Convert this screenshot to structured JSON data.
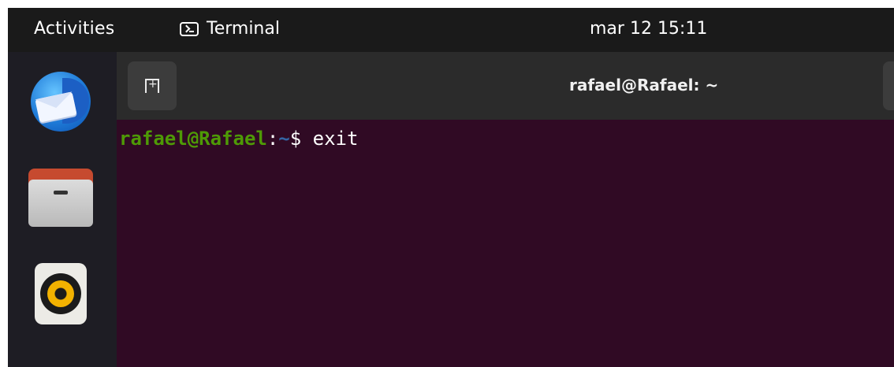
{
  "topbar": {
    "activities_label": "Activities",
    "app_name": "Terminal",
    "clock": "mar 12  15:11"
  },
  "dock": {
    "items": [
      {
        "name": "Thunderbird",
        "icon": "thunderbird-icon"
      },
      {
        "name": "Files",
        "icon": "folder-icon"
      },
      {
        "name": "Rhythmbox",
        "icon": "speaker-icon"
      }
    ]
  },
  "terminal": {
    "title": "rafael@Rafael: ~",
    "new_tab_icon": "new-tab-icon",
    "prompt": {
      "user_host": "rafael@Rafael",
      "colon": ":",
      "path": "~",
      "dollar": "$ ",
      "command": "exit"
    }
  },
  "colors": {
    "terminal_bg": "#300a24",
    "topbar_bg": "#1a1a1a",
    "prompt_user": "#4e9a06",
    "prompt_path": "#3465a4"
  }
}
